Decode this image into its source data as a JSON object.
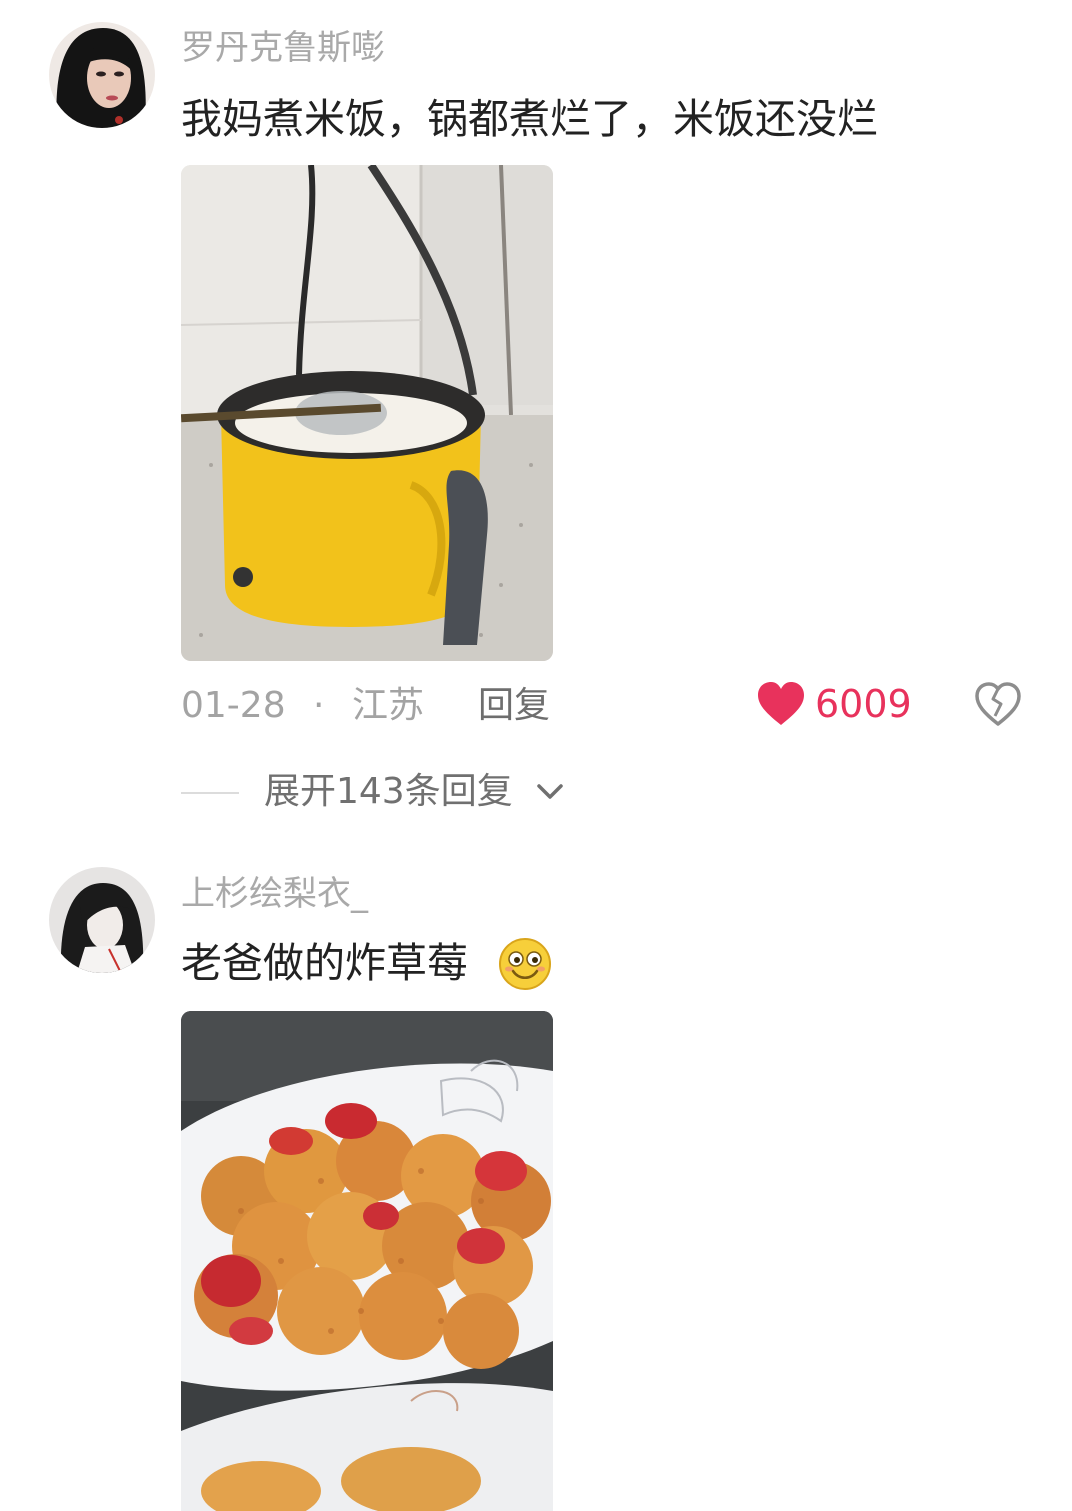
{
  "comments": [
    {
      "username": "罗丹克鲁斯嘭",
      "text": "我妈煮米饭，锅都煮烂了，米饭还没烂",
      "image_icon": "photo-yellow-cooker",
      "date": "01-28",
      "separator": "·",
      "location": "江苏",
      "reply_label": "回复",
      "likes": "6009",
      "like_icon": "heart-filled-icon",
      "dislike_icon": "heart-broken-icon",
      "expand_label": "展开143条回复",
      "expand_icon": "chevron-down-icon"
    },
    {
      "username": "上杉绘梨衣_",
      "text": "老爸做的炸草莓",
      "emoji_icon": "smile-emoji-icon",
      "image_icon": "photo-fried-strawberries"
    }
  ],
  "colors": {
    "username": "#a9a9a9",
    "text": "#222222",
    "like": "#e8325c"
  }
}
